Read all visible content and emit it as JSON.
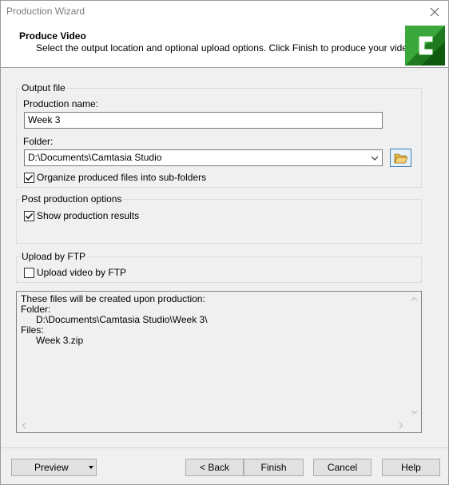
{
  "window": {
    "title": "Production Wizard"
  },
  "header": {
    "title": "Produce Video",
    "subtitle": "Select the output location and optional upload options. Click Finish to produce your video."
  },
  "output_file": {
    "legend": "Output file",
    "production_name_label": "Production name:",
    "production_name_value": "Week 3",
    "folder_label": "Folder:",
    "folder_value": "D:\\Documents\\Camtasia Studio",
    "organize_label": "Organize produced files into sub-folders",
    "organize_checked": true
  },
  "post_production": {
    "legend": "Post production options",
    "show_results_label": "Show production results",
    "show_results_checked": true
  },
  "upload_ftp": {
    "legend": "Upload by FTP",
    "upload_label": "Upload video by FTP",
    "upload_checked": false
  },
  "info": {
    "line1": "These files will be created upon production:",
    "folder_heading": "Folder:",
    "folder_path": "D:\\Documents\\Camtasia Studio\\Week 3\\",
    "files_heading": "Files:",
    "file_name": "Week 3.zip"
  },
  "footer": {
    "preview_label": "Preview",
    "back_label": "< Back",
    "finish_label": "Finish",
    "cancel_label": "Cancel",
    "help_label": "Help"
  },
  "colors": {
    "logo_green": "#2e8b2e",
    "logo_light": "#7ed957",
    "folder_button_border": "#3c7fb1"
  }
}
